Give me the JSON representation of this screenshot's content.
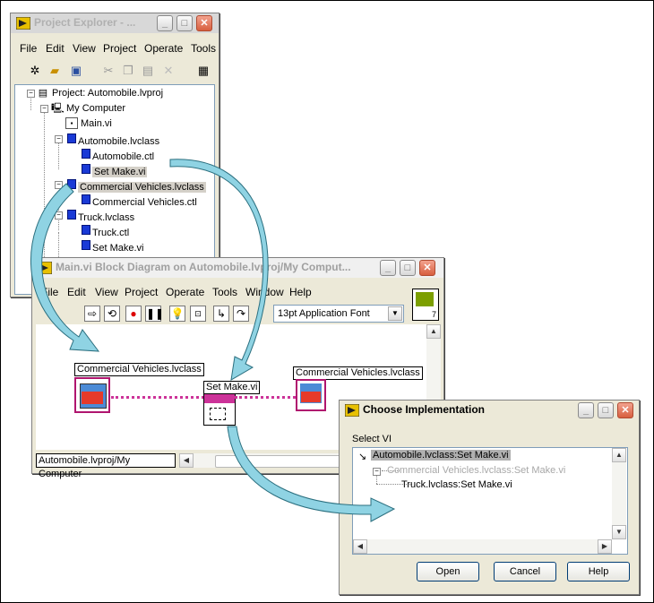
{
  "project_explorer": {
    "title": "Project Explorer - ...",
    "menu": [
      "File",
      "Edit",
      "View",
      "Project",
      "Operate",
      "Tools"
    ],
    "tree": {
      "root": "Project: Automobile.lvproj",
      "computer": "My Computer",
      "main_vi": "Main.vi",
      "automobile_class": "Automobile.lvclass",
      "automobile_ctl": "Automobile.ctl",
      "automobile_setmake": "Set Make.vi",
      "commercial_class": "Commercial Vehicles.lvclass",
      "commercial_ctl": "Commercial Vehicles.ctl",
      "truck_class": "Truck.lvclass",
      "truck_ctl": "Truck.ctl",
      "truck_setmake": "Set Make.vi"
    }
  },
  "block_diagram": {
    "title": "Main.vi Block Diagram on Automobile.lvproj/My Comput...",
    "menu": [
      "File",
      "Edit",
      "View",
      "Project",
      "Operate",
      "Tools",
      "Window",
      "Help"
    ],
    "font_select": "13pt Application Font",
    "connector_number": "7",
    "label_commercial_left": "Commercial Vehicles.lvclass",
    "label_setmake": "Set Make.vi",
    "label_commercial_right": "Commercial Vehicles.lvclass",
    "status_path": "Automobile.lvproj/My Computer"
  },
  "choose_impl": {
    "title": "Choose Implementation",
    "label": "Select VI",
    "items": [
      "Automobile.lvclass:Set Make.vi",
      "Commercial Vehicles.lvclass:Set Make.vi",
      "Truck.lvclass:Set Make.vi"
    ],
    "buttons": {
      "open": "Open",
      "cancel": "Cancel",
      "help": "Help"
    }
  },
  "colors": {
    "arrow": "#8fd3e3",
    "arrow_stroke": "#2b6f7f",
    "wire": "#cc3399",
    "selection": "#d4d0c8",
    "tree_cube": "#1a3ad6"
  },
  "icons": [
    "labview-icon",
    "minimize-icon",
    "maximize-icon",
    "close-icon",
    "new-icon",
    "open-icon",
    "save-icon",
    "cut-icon",
    "copy-icon",
    "paste-icon",
    "delete-icon",
    "run-icon",
    "run-continuous-icon",
    "abort-icon",
    "pause-icon",
    "highlight-icon",
    "retain-wire-icon",
    "step-into-icon",
    "step-over-icon",
    "step-out-icon",
    "class-cube-icon",
    "computer-icon",
    "vi-icon",
    "ctl-icon"
  ]
}
